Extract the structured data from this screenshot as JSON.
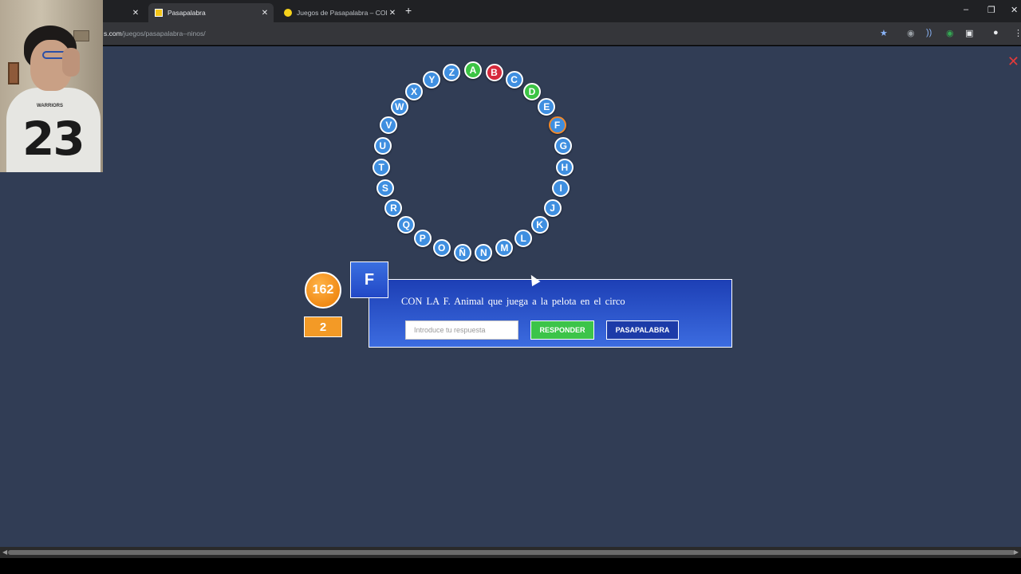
{
  "browser": {
    "tabs": [
      {
        "title": "",
        "close": "✕"
      },
      {
        "title": "Pasapalabra",
        "close": "✕"
      },
      {
        "title": "Juegos de Pasapalabra – COKITOS",
        "close": "✕"
      }
    ],
    "new_tab": "+",
    "window_controls": {
      "minimize": "–",
      "restore": "❐",
      "close": "✕"
    },
    "address": {
      "host": "s.com",
      "path": "/juegos/pasapalabra--ninos/"
    },
    "bookmark_star": "★",
    "extension_icons": [
      "globe-icon",
      "sound-icon",
      "extension-green-icon",
      "puzzle-icon",
      "profile-icon",
      "menu-icon"
    ]
  },
  "game": {
    "close": "✕",
    "letters": [
      {
        "letter": "A",
        "status": "correct"
      },
      {
        "letter": "B",
        "status": "wrong"
      },
      {
        "letter": "C",
        "status": "pending"
      },
      {
        "letter": "D",
        "status": "correct"
      },
      {
        "letter": "E",
        "status": "pending"
      },
      {
        "letter": "F",
        "status": "current"
      },
      {
        "letter": "G",
        "status": "pending"
      },
      {
        "letter": "H",
        "status": "pending"
      },
      {
        "letter": "I",
        "status": "pending"
      },
      {
        "letter": "J",
        "status": "pending"
      },
      {
        "letter": "K",
        "status": "pending"
      },
      {
        "letter": "L",
        "status": "pending"
      },
      {
        "letter": "M",
        "status": "pending"
      },
      {
        "letter": "N",
        "status": "pending"
      },
      {
        "letter": "Ñ",
        "status": "pending"
      },
      {
        "letter": "O",
        "status": "pending"
      },
      {
        "letter": "P",
        "status": "pending"
      },
      {
        "letter": "Q",
        "status": "pending"
      },
      {
        "letter": "R",
        "status": "pending"
      },
      {
        "letter": "S",
        "status": "pending"
      },
      {
        "letter": "T",
        "status": "pending"
      },
      {
        "letter": "U",
        "status": "pending"
      },
      {
        "letter": "V",
        "status": "pending"
      },
      {
        "letter": "W",
        "status": "pending"
      },
      {
        "letter": "X",
        "status": "pending"
      },
      {
        "letter": "Y",
        "status": "pending"
      },
      {
        "letter": "Z",
        "status": "pending"
      }
    ],
    "timer": "162",
    "score": "2",
    "current_letter": "F",
    "question": "CON LA F. Animal que juega a la pelota en el circo",
    "answer_placeholder": "Introduce tu respuesta",
    "answer_value": "",
    "respond_label": "RESPONDER",
    "pass_label": "PASAPALABRA",
    "colors": {
      "pending": "#3f8fe0",
      "correct": "#3cc444",
      "wrong": "#d6293b",
      "current_border": "#f08a2e",
      "timer": "#f08a16",
      "background": "#313d55"
    }
  },
  "webcam": {
    "shirt_number": "23",
    "shirt_text": "WARRIORS"
  }
}
